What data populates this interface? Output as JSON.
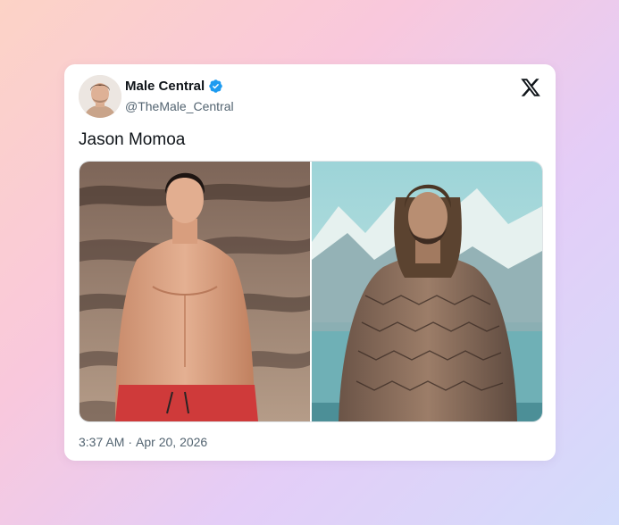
{
  "tweet": {
    "author": {
      "display_name": "Male Central",
      "handle": "@TheMale_Central",
      "verified": true
    },
    "text": "Jason Momoa",
    "time": "3:37 AM",
    "separator": "·",
    "date": "Apr 20, 2026",
    "platform_icon": "x-logo-icon",
    "media": [
      {
        "icon": "photo-icon",
        "subject": "young shirtless man in red swim shorts on rocky beach"
      },
      {
        "icon": "photo-icon",
        "subject": "long-haired bearded man in scaled armor standing in water"
      }
    ]
  },
  "colors": {
    "background_gradient": [
      "#fcd3c6",
      "#f9c8dc",
      "#e4cdf7",
      "#d3dcfb"
    ],
    "card": "#ffffff",
    "text_primary": "#0f1419",
    "text_secondary": "#536471",
    "verified_badge": "#1d9bf0"
  }
}
